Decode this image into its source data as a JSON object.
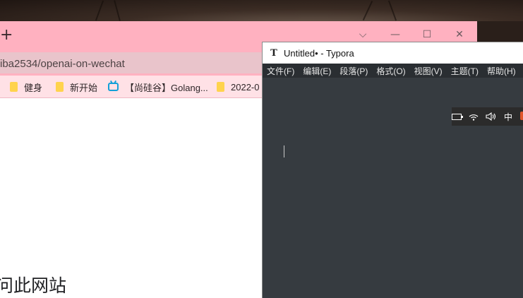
{
  "browser": {
    "new_tab_label": "+",
    "controls": {
      "dropdown": "⌵",
      "minimize": "—",
      "maximize": "☐",
      "close": "✕"
    },
    "address": "iba2534/openai-on-wechat",
    "bookmarks": [
      {
        "label": "健身",
        "icon": "folder-icon"
      },
      {
        "label": "新开始",
        "icon": "folder-icon"
      },
      {
        "label": "【尚硅谷】Golang...",
        "icon": "bilibili-icon"
      },
      {
        "label": "2022-0",
        "icon": "folder-icon"
      }
    ],
    "page_text": "问此网站"
  },
  "typora": {
    "app_icon_glyph": "T",
    "title": "Untitled• - Typora",
    "menu": [
      "文件(F)",
      "编辑(E)",
      "段落(P)",
      "格式(O)",
      "视图(V)",
      "主题(T)",
      "帮助(H)"
    ]
  },
  "tray": {
    "ime_label": "中",
    "icons": [
      "battery-icon",
      "wifi-icon",
      "volume-icon"
    ]
  },
  "colors": {
    "browser_accent": "#ffb1c0",
    "typora_editor_bg": "#363b40"
  }
}
